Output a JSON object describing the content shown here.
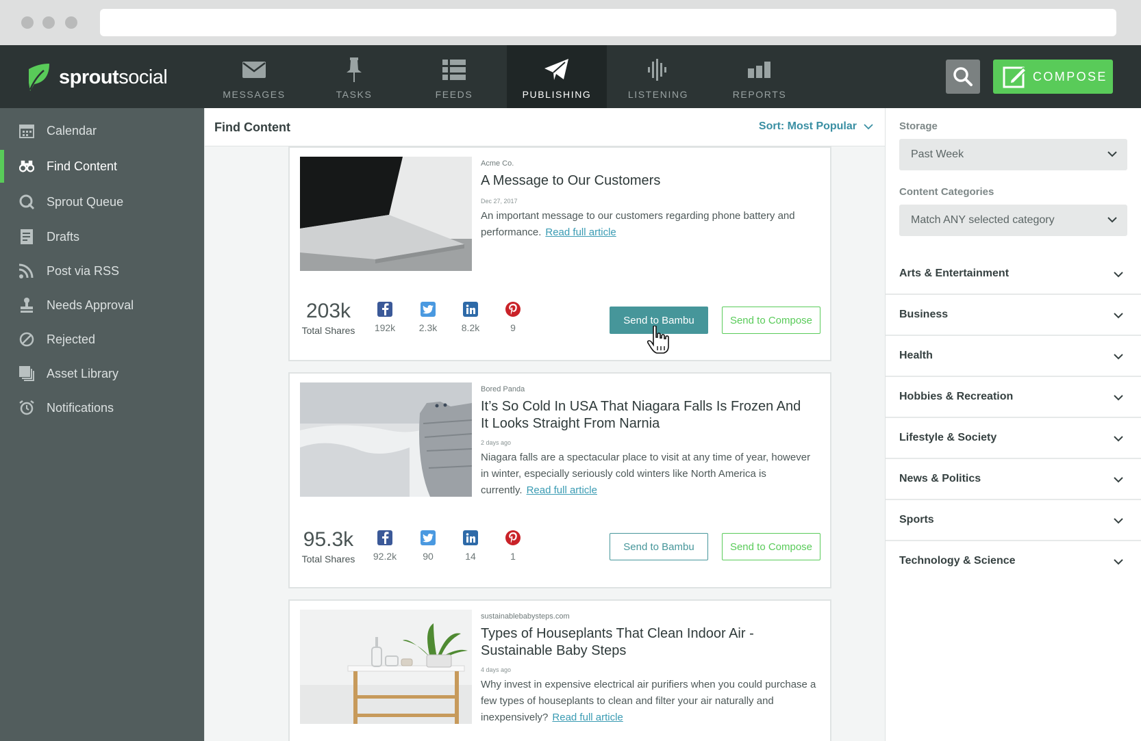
{
  "app": {
    "logo_bold": "sprout",
    "logo_light": "social"
  },
  "topnav": {
    "tabs": [
      {
        "label": "MESSAGES",
        "icon": "envelope-icon"
      },
      {
        "label": "TASKS",
        "icon": "pin-icon"
      },
      {
        "label": "FEEDS",
        "icon": "list-icon"
      },
      {
        "label": "PUBLISHING",
        "icon": "paper-plane-icon",
        "active": true
      },
      {
        "label": "LISTENING",
        "icon": "waveform-icon"
      },
      {
        "label": "REPORTS",
        "icon": "bar-chart-icon"
      }
    ],
    "compose_label": "COMPOSE"
  },
  "sidebar": {
    "items": [
      {
        "label": "Calendar",
        "icon": "calendar-icon"
      },
      {
        "label": "Find Content",
        "icon": "binoculars-icon",
        "active": true
      },
      {
        "label": "Sprout Queue",
        "icon": "queue-icon"
      },
      {
        "label": "Drafts",
        "icon": "document-icon"
      },
      {
        "label": "Post via RSS",
        "icon": "rss-icon"
      },
      {
        "label": "Needs Approval",
        "icon": "stamp-icon"
      },
      {
        "label": "Rejected",
        "icon": "ban-icon"
      },
      {
        "label": "Asset Library",
        "icon": "stack-icon"
      },
      {
        "label": "Notifications",
        "icon": "alarm-clock-icon"
      }
    ]
  },
  "main": {
    "title": "Find Content",
    "sort_label": "Sort: Most Popular",
    "cards": [
      {
        "source": "Acme Co.",
        "title": "A Message to Our Customers",
        "date": "Dec 27, 2017",
        "description": "An important message to our customers regarding phone battery and performance.",
        "link": "Read full article",
        "total_shares": "203k",
        "total_label": "Total Shares",
        "facebook": "192k",
        "twitter": "2.3k",
        "linkedin": "8.2k",
        "pinterest": "9",
        "bambu_label": "Send to Bambu",
        "compose_label": "Send to Compose"
      },
      {
        "source": "Bored Panda",
        "title": "It’s So Cold In USA That Niagara Falls Is Frozen And It Looks Straight From Narnia",
        "date": "2 days ago",
        "description": "Niagara falls are a spectacular place to visit at any time of year, however in winter, especially seriously cold winters like North America is currently.",
        "link": "Read full article",
        "total_shares": "95.3k",
        "total_label": "Total Shares",
        "facebook": "92.2k",
        "twitter": "90",
        "linkedin": "14",
        "pinterest": "1",
        "bambu_label": "Send to Bambu",
        "compose_label": "Send to Compose"
      },
      {
        "source": "sustainablebabysteps.com",
        "title": "Types of Houseplants That Clean Indoor Air - Sustainable Baby Steps",
        "date": "4 days ago",
        "description": "Why invest in expensive electrical air purifiers when you could purchase a few types of houseplants to clean and filter your air naturally and inexpensively?",
        "link": "Read full article"
      }
    ]
  },
  "filters": {
    "storage_label": "Storage",
    "storage_value": "Past Week",
    "categories_label": "Content Categories",
    "categories_value": "Match ANY selected category",
    "categories": [
      "Arts & Entertainment",
      "Business",
      "Health",
      "Hobbies & Recreation",
      "Lifestyle & Society",
      "News & Politics",
      "Sports",
      "Technology & Science"
    ]
  },
  "colors": {
    "accent_green": "#59cb59",
    "teal": "#46969a",
    "link": "#3a9bb3",
    "nav_bg": "#2c3434",
    "sidebar_bg": "#525d5d"
  }
}
